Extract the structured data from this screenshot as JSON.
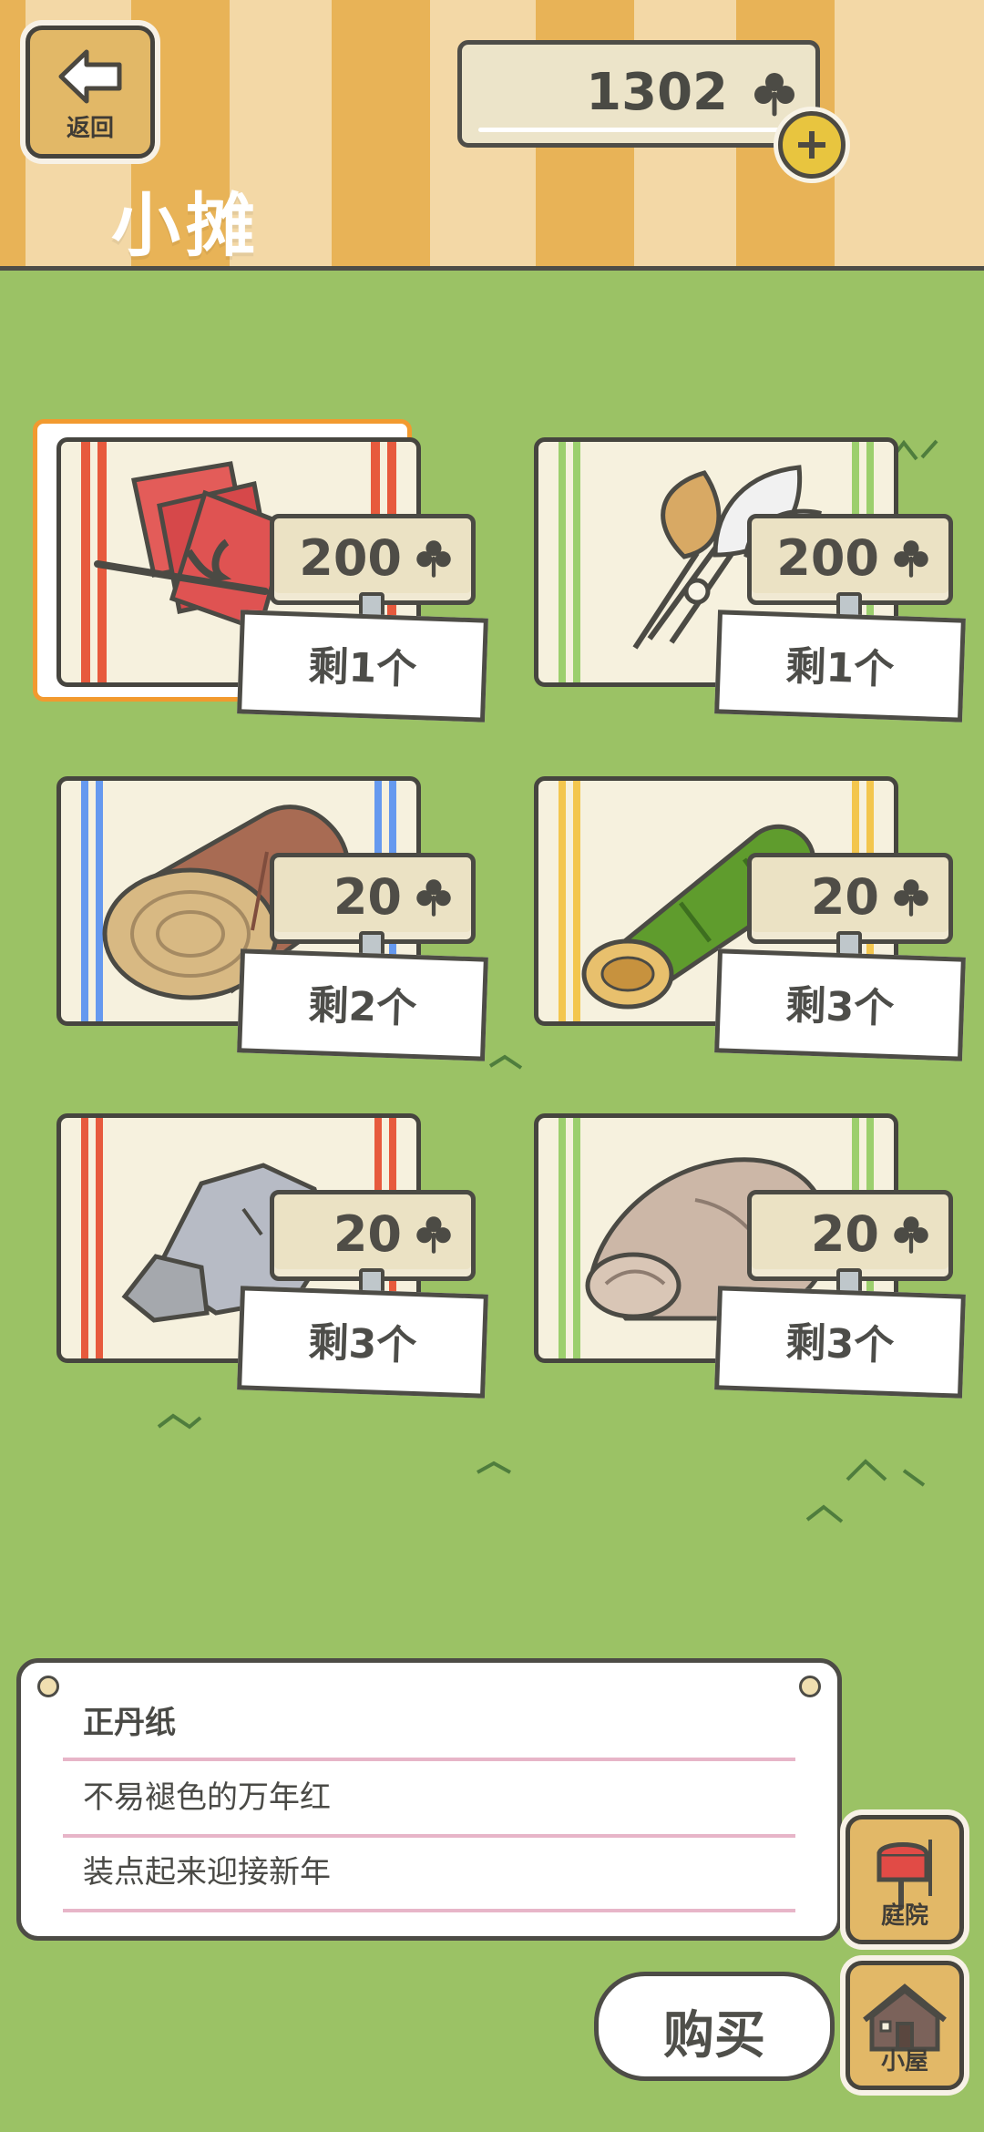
{
  "header": {
    "back_label": "返回",
    "title": "小摊",
    "currency_value": "1302"
  },
  "items": [
    {
      "name": "正丹纸",
      "price": "200",
      "stock": "剩1个",
      "selected": true
    },
    {
      "name": "",
      "price": "200",
      "stock": "剩1个",
      "selected": false
    },
    {
      "name": "",
      "price": "20",
      "stock": "剩2个",
      "selected": false
    },
    {
      "name": "",
      "price": "20",
      "stock": "剩3个",
      "selected": false
    },
    {
      "name": "",
      "price": "20",
      "stock": "剩3个",
      "selected": false
    },
    {
      "name": "",
      "price": "20",
      "stock": "剩3个",
      "selected": false
    }
  ],
  "description": {
    "name": "正丹纸",
    "line1": "不易褪色的万年红",
    "line2": "装点起来迎接新年"
  },
  "buttons": {
    "yard": "庭院",
    "buy": "购买",
    "house": "小屋"
  },
  "colors": {
    "background": "#9bc265",
    "accent": "#f29a2f",
    "wood": "#e2b867"
  },
  "icons": [
    "back-arrow-icon",
    "clover-icon",
    "plus-icon",
    "mailbox-icon",
    "house-icon"
  ]
}
